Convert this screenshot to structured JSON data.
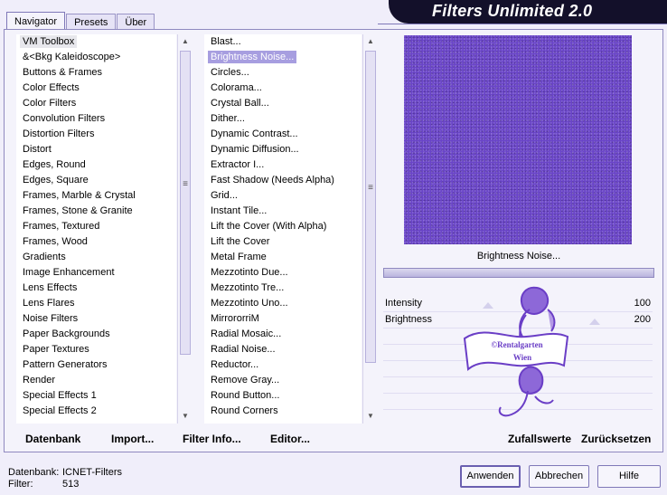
{
  "tabs": [
    "Navigator",
    "Presets",
    "Über"
  ],
  "banner_title": "Filters Unlimited 2.0",
  "categories": [
    "VM Toolbox",
    "&<Bkg Kaleidoscope>",
    "Buttons & Frames",
    "Color Effects",
    "Color Filters",
    "Convolution Filters",
    "Distortion Filters",
    "Distort",
    "Edges, Round",
    "Edges, Square",
    "Frames, Marble & Crystal",
    "Frames, Stone & Granite",
    "Frames, Textured",
    "Frames, Wood",
    "Gradients",
    "Image Enhancement",
    "Lens Effects",
    "Lens Flares",
    "Noise Filters",
    "Paper Backgrounds",
    "Paper Textures",
    "Pattern Generators",
    "Render",
    "Special Effects 1",
    "Special Effects 2"
  ],
  "filters": [
    "Blast...",
    "Brightness Noise...",
    "Circles...",
    "Colorama...",
    "Crystal Ball...",
    "Dither...",
    "Dynamic Contrast...",
    "Dynamic Diffusion...",
    "Extractor I...",
    "Fast Shadow (Needs Alpha)",
    "Grid...",
    "Instant Tile...",
    "Lift the Cover (With Alpha)",
    "Lift the Cover",
    "Metal Frame",
    "Mezzotinto Due...",
    "Mezzotinto Tre...",
    "Mezzotinto Uno...",
    "MirrororriM",
    "Radial Mosaic...",
    "Radial Noise...",
    "Reductor...",
    "Remove Gray...",
    "Round Button...",
    "Round Corners"
  ],
  "selected_filter_label": "Brightness Noise...",
  "params": [
    {
      "label": "Intensity",
      "value": "100"
    },
    {
      "label": "Brightness",
      "value": "200"
    }
  ],
  "bottom_left_buttons": [
    "Datenbank",
    "Import...",
    "Filter Info...",
    "Editor..."
  ],
  "bottom_right_buttons": [
    "Zufallswerte",
    "Zurücksetzen"
  ],
  "status": {
    "db_label": "Datenbank:",
    "db_value": "ICNET-Filters",
    "filter_label": "Filter:",
    "filter_value": "513"
  },
  "buttons": {
    "apply": "Anwenden",
    "cancel": "Abbrechen",
    "help": "Hilfe"
  },
  "watermark_text": [
    "©Rentalgarten",
    "Wien"
  ],
  "colors": {
    "preview": "#6a45c8",
    "selection": "#a79ee0",
    "banner": "#13102a",
    "watermark": "#6a3ec6"
  }
}
